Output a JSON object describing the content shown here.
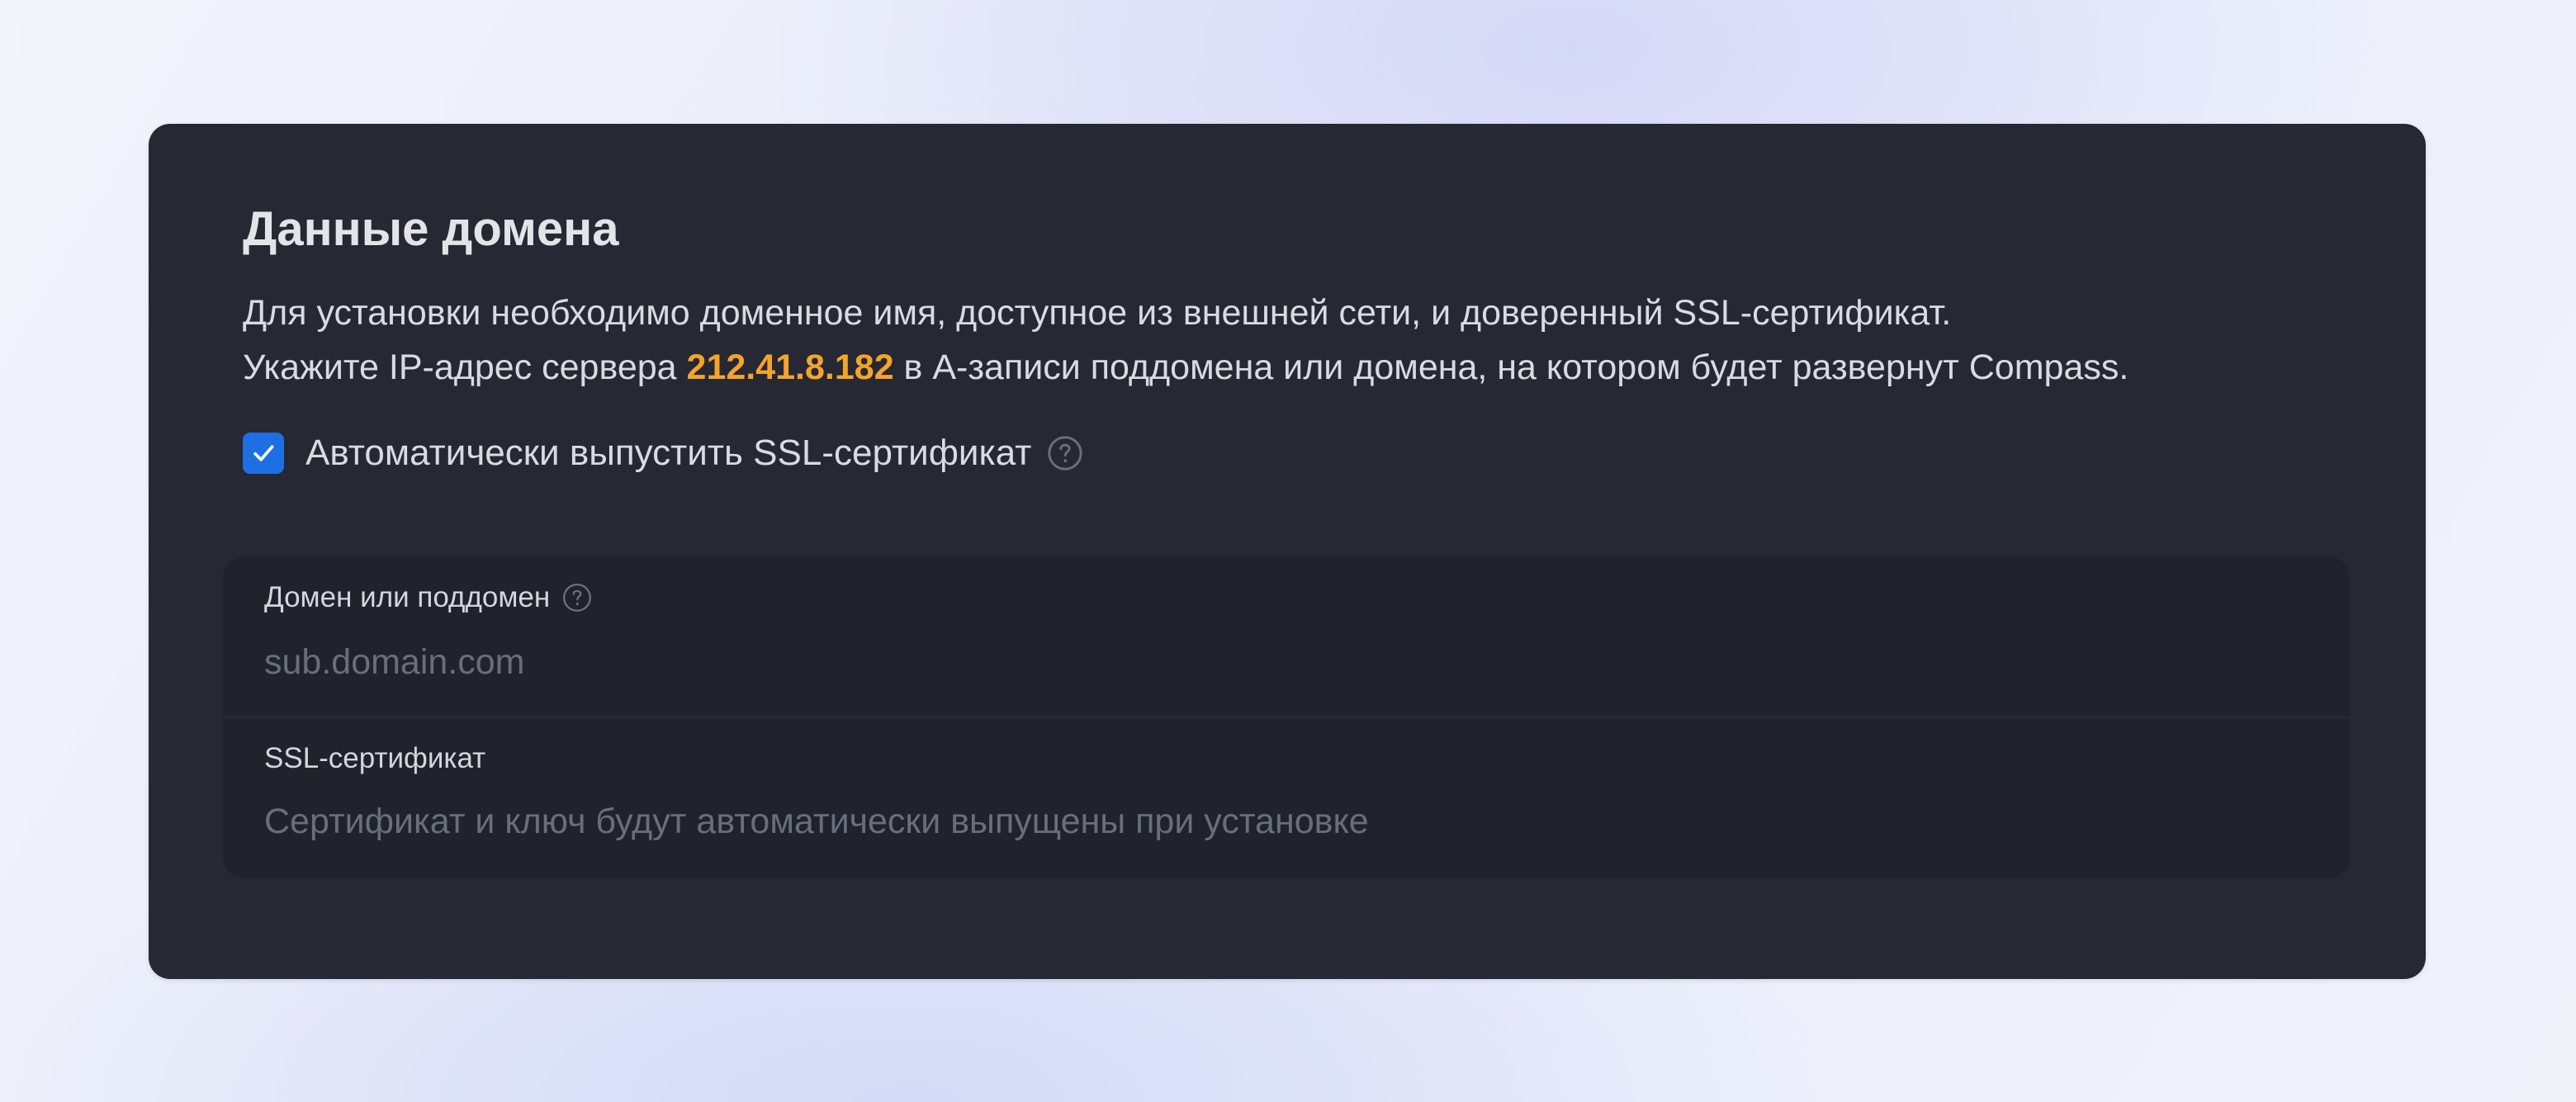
{
  "card": {
    "title": "Данные домена",
    "description": {
      "line1": "Для установки необходимо доменное имя, доступное из внешней сети, и доверенный SSL-сертификат.",
      "line2_prefix": "Укажите IP-адрес сервера ",
      "ip_address": "212.41.8.182",
      "line2_suffix": " в А-записи поддомена или домена, на котором будет развернут Compass."
    },
    "auto_ssl": {
      "label": "Автоматически выпустить SSL-сертификат",
      "checked": true,
      "icon": "help-circle-icon"
    }
  },
  "fields": {
    "domain": {
      "label": "Домен или поддомен",
      "value": "",
      "placeholder": "sub.domain.com",
      "icon": "help-circle-icon"
    },
    "ssl_certificate": {
      "label": "SSL-сертификат",
      "text": "Сертификат и ключ будут автоматически выпущены при установке"
    }
  },
  "colors": {
    "card_background": "#262834",
    "fields_background": "#20222c",
    "ip_highlight": "#f4a42b",
    "checkbox_accent": "#1e6fe3",
    "placeholder": "#6a6e7b"
  }
}
